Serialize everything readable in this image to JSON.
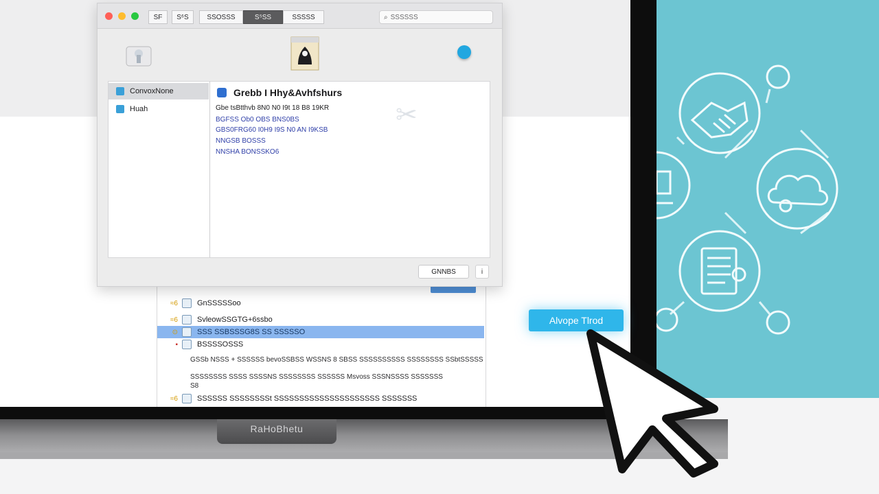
{
  "window": {
    "tabs": [
      "SF",
      "S⁶S",
      "SSOSSS",
      "S⁵SS",
      "SSSSS"
    ],
    "active_tab_index": 3,
    "search_placeholder": "SSSSSS"
  },
  "sidebar": {
    "items": [
      {
        "label": "ConvoxNone",
        "selected": true
      },
      {
        "label": "Huah",
        "selected": false
      }
    ]
  },
  "content": {
    "heading": "Grebb I Hhy&Avhfshurs",
    "line1": "Gbe tsBtthvb 8N0 N0 I9t 18 B8 19KR",
    "line2": "BGFSS  Ob0 OBS  BNS0BS",
    "line3": "GBS0FRG60 I0H9 I9S N0 AN I9KSB",
    "line4": "NNGSB  BOSSS",
    "line5": "NNSHA  BONSSKO6"
  },
  "bottom_bar": {
    "button_label": "GNNBS",
    "info_label": "i"
  },
  "back_window": {
    "rows": [
      {
        "label": "GnSSSSSoo",
        "mark": "≈6",
        "selected": false
      },
      {
        "label": "SvleowSSGTG+6ssbo",
        "mark": "≈6",
        "selected": false
      },
      {
        "label": "SSS SSBSSSG8S SS SSSSSO",
        "mark": "⊙",
        "selected": true
      },
      {
        "label": "BSSSSOSSS",
        "mark": "▪",
        "selected": false
      }
    ],
    "para1": "GSSb NSSS + SSSSSS bevoSSBSS WSSNS 8 SBSS SSSSSSSSSS SSSSSSSS SSbtSSSSS",
    "para2": "SSSSSSSS SSSS SSSSNS SSSSSSSS SSSSSS Msvoss SSSNSSSS SSSSSSS",
    "para3": "S8",
    "last_row": {
      "label": "SSSSSS SSSSSSSSt SSSSSSSSSSSSSSSSSSSSS SSSSSSS",
      "mark": "≈6"
    }
  },
  "float_button_label": "Alvope Tlrod",
  "brand_label": "RaHoBhetu",
  "colors": {
    "teal_panel": "#6cc5d2",
    "float_button": "#2fb6ea",
    "selection": "#8ab6ef"
  }
}
